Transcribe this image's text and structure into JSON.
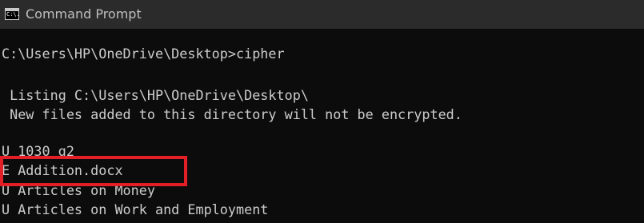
{
  "window": {
    "title": "Command Prompt",
    "icon_text": "C:\\."
  },
  "console": {
    "lines": [
      "C:\\Users\\HP\\OneDrive\\Desktop>cipher",
      " Listing C:\\Users\\HP\\OneDrive\\Desktop\\",
      " New files added to this directory will not be encrypted.",
      "U 1030 g2",
      "E Addition.docx",
      "U Articles on Money",
      "U Articles on Work and Employment"
    ]
  },
  "annotation": {
    "highlight_color": "#e41e26"
  },
  "colors": {
    "background": "#0c0c0c",
    "titlebar": "#2b2b2b",
    "text": "#cccccc"
  }
}
